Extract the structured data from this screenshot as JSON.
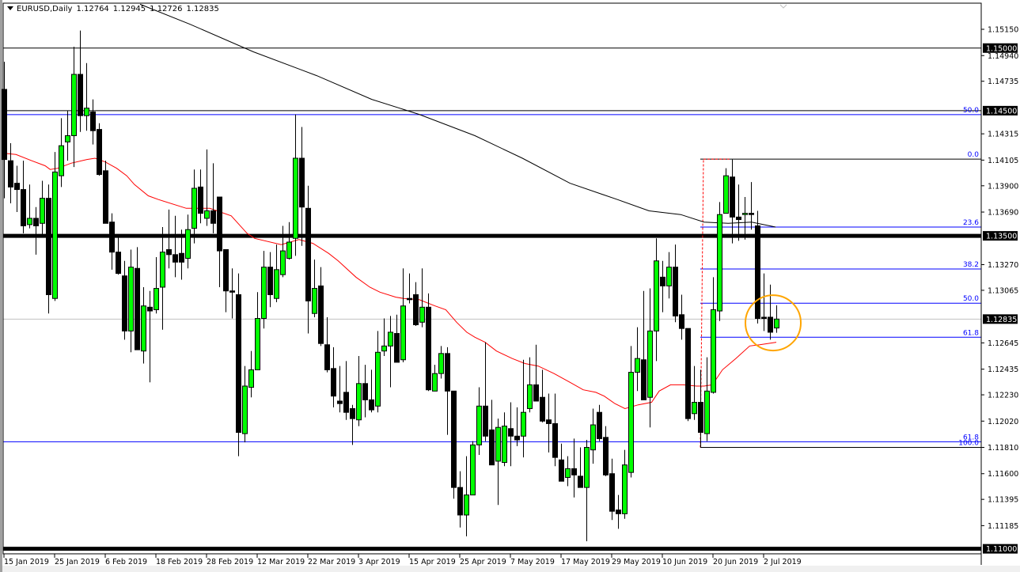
{
  "header": {
    "symbol_timeframe": "EURUSD,Daily",
    "open": "1.12764",
    "high": "1.12945",
    "low": "1.12726",
    "close": "1.12835"
  },
  "colors": {
    "bull_body": "#00ff00",
    "bear_body": "#000000",
    "ma_fast": "#ff0000",
    "ma_slow": "#000000",
    "fib": "#0000ff",
    "highlight_circle": "#ffa500",
    "current_price_line": "#c0c0c0"
  },
  "chart_data": {
    "type": "candlestick",
    "title": "EURUSD,Daily",
    "ylim": [
      1.10975,
      1.15384
    ],
    "y_ticks": [
      "1.15150",
      "1.14940",
      "1.14735",
      "1.14315",
      "1.14105",
      "1.13900",
      "1.13690",
      "1.13270",
      "1.13065",
      "1.12645",
      "1.12435",
      "1.12230",
      "1.12020",
      "1.11810",
      "1.11600",
      "1.11395",
      "1.11185"
    ],
    "x_ticks": [
      {
        "index": 0,
        "label": "15 Jan 2019"
      },
      {
        "index": 8,
        "label": "25 Jan 2019"
      },
      {
        "index": 16,
        "label": "6 Feb 2019"
      },
      {
        "index": 24,
        "label": "18 Feb 2019"
      },
      {
        "index": 32,
        "label": "28 Feb 2019"
      },
      {
        "index": 40,
        "label": "12 Mar 2019"
      },
      {
        "index": 48,
        "label": "22 Mar 2019"
      },
      {
        "index": 56,
        "label": "3 Apr 2019"
      },
      {
        "index": 64,
        "label": "15 Apr 2019"
      },
      {
        "index": 72,
        "label": "25 Apr 2019"
      },
      {
        "index": 80,
        "label": "7 May 2019"
      },
      {
        "index": 88,
        "label": "17 May 2019"
      },
      {
        "index": 96,
        "label": "29 May 2019"
      },
      {
        "index": 104,
        "label": "10 Jun 2019"
      },
      {
        "index": 112,
        "label": "20 Jun 2019"
      },
      {
        "index": 120,
        "label": "2 Jul 2019"
      }
    ],
    "ohlc_order": [
      "open",
      "high",
      "low",
      "close"
    ],
    "candles": [
      [
        1.1467,
        1.1489,
        1.138,
        1.1411
      ],
      [
        1.141,
        1.1424,
        1.1376,
        1.1389
      ],
      [
        1.1392,
        1.1406,
        1.1369,
        1.1387
      ],
      [
        1.1387,
        1.141,
        1.1352,
        1.1358
      ],
      [
        1.1359,
        1.1391,
        1.1356,
        1.1364
      ],
      [
        1.1364,
        1.1373,
        1.1335,
        1.1358
      ],
      [
        1.136,
        1.1394,
        1.1351,
        1.138
      ],
      [
        1.138,
        1.1391,
        1.1288,
        1.1303
      ],
      [
        1.13,
        1.1417,
        1.1298,
        1.1401
      ],
      [
        1.1398,
        1.1444,
        1.1389,
        1.1422
      ],
      [
        1.1425,
        1.145,
        1.141,
        1.143
      ],
      [
        1.143,
        1.1501,
        1.1405,
        1.1479
      ],
      [
        1.1479,
        1.1514,
        1.1433,
        1.1446
      ],
      [
        1.1446,
        1.1488,
        1.1434,
        1.1452
      ],
      [
        1.1449,
        1.1459,
        1.1423,
        1.1434
      ],
      [
        1.1435,
        1.144,
        1.1398,
        1.1399
      ],
      [
        1.1402,
        1.141,
        1.136,
        1.136
      ],
      [
        1.1361,
        1.1368,
        1.1323,
        1.1337
      ],
      [
        1.1337,
        1.1349,
        1.1319,
        1.132
      ],
      [
        1.1318,
        1.133,
        1.1267,
        1.1274
      ],
      [
        1.1274,
        1.1339,
        1.1257,
        1.1325
      ],
      [
        1.1324,
        1.1341,
        1.1259,
        1.1259
      ],
      [
        1.1258,
        1.1309,
        1.1248,
        1.1294
      ],
      [
        1.1293,
        1.1306,
        1.1233,
        1.129
      ],
      [
        1.1291,
        1.1333,
        1.1288,
        1.1308
      ],
      [
        1.1309,
        1.1357,
        1.1275,
        1.1337
      ],
      [
        1.1339,
        1.1371,
        1.1324,
        1.1335
      ],
      [
        1.1335,
        1.1366,
        1.1317,
        1.1329
      ],
      [
        1.1336,
        1.1355,
        1.1315,
        1.1329
      ],
      [
        1.1332,
        1.1367,
        1.1324,
        1.1355
      ],
      [
        1.1356,
        1.1403,
        1.1344,
        1.1388
      ],
      [
        1.1389,
        1.1403,
        1.136,
        1.1368
      ],
      [
        1.1364,
        1.1419,
        1.1358,
        1.137
      ],
      [
        1.137,
        1.1408,
        1.1352,
        1.136
      ],
      [
        1.1381,
        1.1381,
        1.1309,
        1.1338
      ],
      [
        1.1339,
        1.1339,
        1.1289,
        1.1306
      ],
      [
        1.1306,
        1.1324,
        1.1284,
        1.1305
      ],
      [
        1.1303,
        1.132,
        1.1174,
        1.1193
      ],
      [
        1.1192,
        1.1246,
        1.1185,
        1.123
      ],
      [
        1.1229,
        1.1258,
        1.1221,
        1.1243
      ],
      [
        1.1243,
        1.1305,
        1.1243,
        1.1284
      ],
      [
        1.1284,
        1.1338,
        1.1276,
        1.1325
      ],
      [
        1.1325,
        1.1337,
        1.1293,
        1.1303
      ],
      [
        1.13,
        1.1343,
        1.1297,
        1.1323
      ],
      [
        1.1319,
        1.1358,
        1.1317,
        1.1338
      ],
      [
        1.1332,
        1.1361,
        1.1331,
        1.1345
      ],
      [
        1.1348,
        1.1447,
        1.1334,
        1.1412
      ],
      [
        1.1412,
        1.1437,
        1.1342,
        1.1373
      ],
      [
        1.1372,
        1.139,
        1.1272,
        1.1298
      ],
      [
        1.1288,
        1.1331,
        1.1285,
        1.1308
      ],
      [
        1.131,
        1.1325,
        1.1262,
        1.1264
      ],
      [
        1.1263,
        1.1285,
        1.1241,
        1.1243
      ],
      [
        1.1244,
        1.1261,
        1.1213,
        1.1222
      ],
      [
        1.1218,
        1.1246,
        1.1209,
        1.1216
      ],
      [
        1.1225,
        1.125,
        1.1203,
        1.1209
      ],
      [
        1.1212,
        1.1215,
        1.1183,
        1.1204
      ],
      [
        1.1203,
        1.1254,
        1.1198,
        1.1232
      ],
      [
        1.1232,
        1.1247,
        1.1205,
        1.1219
      ],
      [
        1.1219,
        1.1243,
        1.1209,
        1.1211
      ],
      [
        1.1214,
        1.1274,
        1.1209,
        1.1257
      ],
      [
        1.1258,
        1.1284,
        1.1254,
        1.1262
      ],
      [
        1.1262,
        1.1286,
        1.1229,
        1.1273
      ],
      [
        1.1272,
        1.1287,
        1.1249,
        1.1249
      ],
      [
        1.1251,
        1.1324,
        1.1249,
        1.1294
      ],
      [
        1.13,
        1.132,
        1.1296,
        1.1299
      ],
      [
        1.1303,
        1.1313,
        1.1278,
        1.1279
      ],
      [
        1.1281,
        1.1324,
        1.1277,
        1.1293
      ],
      [
        1.1293,
        1.1304,
        1.1226,
        1.1227
      ],
      [
        1.1226,
        1.1247,
        1.1226,
        1.124
      ],
      [
        1.124,
        1.1262,
        1.1236,
        1.1256
      ],
      [
        1.1256,
        1.1261,
        1.1191,
        1.1226
      ],
      [
        1.1226,
        1.1226,
        1.114,
        1.1149
      ],
      [
        1.1149,
        1.1162,
        1.1117,
        1.1127
      ],
      [
        1.1127,
        1.1174,
        1.111,
        1.1143
      ],
      [
        1.1143,
        1.1186,
        1.1143,
        1.1183
      ],
      [
        1.1183,
        1.1229,
        1.1175,
        1.1214
      ],
      [
        1.1214,
        1.1265,
        1.1186,
        1.119
      ],
      [
        1.1195,
        1.1219,
        1.1167,
        1.1167
      ],
      [
        1.117,
        1.1204,
        1.1135,
        1.1197
      ],
      [
        1.1169,
        1.1209,
        1.1166,
        1.1198
      ],
      [
        1.1196,
        1.1217,
        1.1166,
        1.119
      ],
      [
        1.119,
        1.1213,
        1.1182,
        1.1187
      ],
      [
        1.119,
        1.1251,
        1.1173,
        1.1209
      ],
      [
        1.1212,
        1.1253,
        1.1209,
        1.1231
      ],
      [
        1.1231,
        1.1263,
        1.1218,
        1.1218
      ],
      [
        1.1221,
        1.1243,
        1.1201,
        1.1202
      ],
      [
        1.1203,
        1.1224,
        1.1177,
        1.12
      ],
      [
        1.12,
        1.1224,
        1.1166,
        1.1173
      ],
      [
        1.1171,
        1.1184,
        1.1154,
        1.1154
      ],
      [
        1.1157,
        1.1174,
        1.115,
        1.1164
      ],
      [
        1.1164,
        1.1188,
        1.1141,
        1.1159
      ],
      [
        1.1158,
        1.1181,
        1.1149,
        1.1149
      ],
      [
        1.1149,
        1.1187,
        1.1106,
        1.1181
      ],
      [
        1.1179,
        1.1212,
        1.1168,
        1.1199
      ],
      [
        1.1209,
        1.1215,
        1.1186,
        1.1188
      ],
      [
        1.1189,
        1.1198,
        1.1158,
        1.1159
      ],
      [
        1.116,
        1.1172,
        1.1123,
        1.113
      ],
      [
        1.1131,
        1.1143,
        1.1116,
        1.1128
      ],
      [
        1.1128,
        1.1179,
        1.1124,
        1.1167
      ],
      [
        1.1161,
        1.1262,
        1.1157,
        1.1241
      ],
      [
        1.1241,
        1.1277,
        1.1226,
        1.1252
      ],
      [
        1.1251,
        1.1306,
        1.1219,
        1.1219
      ],
      [
        1.1221,
        1.1308,
        1.1197,
        1.1274
      ],
      [
        1.1274,
        1.1348,
        1.125,
        1.133
      ],
      [
        1.1317,
        1.133,
        1.1289,
        1.131
      ],
      [
        1.131,
        1.1337,
        1.13,
        1.1325
      ],
      [
        1.1325,
        1.1343,
        1.1281,
        1.1286
      ],
      [
        1.1287,
        1.1303,
        1.1267,
        1.1276
      ],
      [
        1.1276,
        1.1276,
        1.1202,
        1.1204
      ],
      [
        1.1208,
        1.1246,
        1.1203,
        1.1217
      ],
      [
        1.1217,
        1.1243,
        1.1181,
        1.1193
      ],
      [
        1.1192,
        1.1253,
        1.1186,
        1.1226
      ],
      [
        1.1225,
        1.1317,
        1.1224,
        1.1291
      ],
      [
        1.129,
        1.1377,
        1.1282,
        1.1367
      ],
      [
        1.1368,
        1.1404,
        1.1368,
        1.1398
      ],
      [
        1.1397,
        1.1411,
        1.1344,
        1.1365
      ],
      [
        1.1365,
        1.1391,
        1.1346,
        1.1363
      ],
      [
        1.1367,
        1.1381,
        1.1347,
        1.1368
      ],
      [
        1.1368,
        1.1393,
        1.1355,
        1.1367
      ],
      [
        1.1358,
        1.137,
        1.128,
        1.1284
      ],
      [
        1.1285,
        1.132,
        1.1274,
        1.1284
      ],
      [
        1.1285,
        1.1311,
        1.1267,
        1.1273
      ],
      [
        1.12764,
        1.12945,
        1.12726,
        1.12835
      ]
    ],
    "series": [
      {
        "name": "ma_fast",
        "points": [
          [
            0,
            1.1416
          ],
          [
            1.9,
            1.1415
          ],
          [
            4.4,
            1.141
          ],
          [
            6.5,
            1.1406
          ],
          [
            7.3,
            1.1403
          ],
          [
            8.5,
            1.1404
          ],
          [
            10.6,
            1.1408
          ],
          [
            13.1,
            1.1411
          ],
          [
            14.4,
            1.1412
          ],
          [
            16,
            1.1409
          ],
          [
            17.8,
            1.1404
          ],
          [
            19.4,
            1.1398
          ],
          [
            20.6,
            1.1391
          ],
          [
            22.8,
            1.1382
          ],
          [
            24.4,
            1.1379
          ],
          [
            28.8,
            1.1372
          ],
          [
            32.5,
            1.1372
          ],
          [
            35.9,
            1.1366
          ],
          [
            38.4,
            1.1352
          ],
          [
            39.6,
            1.1348
          ],
          [
            43.8,
            1.1343
          ],
          [
            46.6,
            1.1347
          ],
          [
            48.8,
            1.1344
          ],
          [
            51.3,
            1.1336
          ],
          [
            52.8,
            1.133
          ],
          [
            55.6,
            1.1317
          ],
          [
            57.8,
            1.1309
          ],
          [
            59.4,
            1.1305
          ],
          [
            61.9,
            1.1301
          ],
          [
            63.1,
            1.13
          ],
          [
            65.6,
            1.1299
          ],
          [
            68.1,
            1.1294
          ],
          [
            69.8,
            1.1291
          ],
          [
            71.5,
            1.1281
          ],
          [
            73.1,
            1.1273
          ],
          [
            74.4,
            1.1269
          ],
          [
            76,
            1.1265
          ],
          [
            77.8,
            1.1258
          ],
          [
            80.3,
            1.1252
          ],
          [
            82.3,
            1.1248
          ],
          [
            84.4,
            1.1246
          ],
          [
            86.9,
            1.124
          ],
          [
            89.4,
            1.1233
          ],
          [
            91.5,
            1.1227
          ],
          [
            93.5,
            1.1225
          ],
          [
            94.8,
            1.1222
          ],
          [
            96.5,
            1.1216
          ],
          [
            98.1,
            1.1212
          ],
          [
            100.2,
            1.1215
          ],
          [
            102.3,
            1.1217
          ],
          [
            103.5,
            1.1226
          ],
          [
            105.3,
            1.1231
          ],
          [
            107.3,
            1.1231
          ],
          [
            109.4,
            1.123
          ],
          [
            110.6,
            1.123
          ],
          [
            111.9,
            1.1231
          ],
          [
            113.5,
            1.1243
          ],
          [
            115.6,
            1.1252
          ],
          [
            117.8,
            1.1262
          ],
          [
            119.4,
            1.1263
          ],
          [
            122,
            1.1265
          ]
        ]
      },
      {
        "name": "ma_slow",
        "points": [
          [
            21.5,
            1.1535
          ],
          [
            29.4,
            1.1519
          ],
          [
            39.4,
            1.1497
          ],
          [
            49.4,
            1.1478
          ],
          [
            58.1,
            1.1459
          ],
          [
            65.6,
            1.1447
          ],
          [
            74.4,
            1.143
          ],
          [
            81.9,
            1.1412
          ],
          [
            89.4,
            1.1392
          ],
          [
            96.9,
            1.1379
          ],
          [
            101.9,
            1.137
          ],
          [
            106.9,
            1.1367
          ],
          [
            110.6,
            1.1361
          ],
          [
            114.4,
            1.136
          ],
          [
            118.1,
            1.1361
          ],
          [
            121.9,
            1.1357
          ]
        ]
      }
    ],
    "horizontal_levels": [
      {
        "price": 1.15,
        "label": "1.15000",
        "style": "thin"
      },
      {
        "price": 1.145,
        "label": "1.14500",
        "style": "thin"
      },
      {
        "price": 1.135,
        "label": "1.13500",
        "style": "thick"
      },
      {
        "price": 1.11,
        "label": "1.11000",
        "style": "thick"
      }
    ],
    "current_price": {
      "price": 1.12835,
      "label": "1.12835"
    },
    "fib_retracement": {
      "from_index": 110,
      "swing_low": 1.1181,
      "swing_high": 1.14113,
      "levels": [
        {
          "label": "0.0",
          "price": 1.14113
        },
        {
          "label": "23.6",
          "price": 1.1357
        },
        {
          "label": "38.2",
          "price": 1.13235
        },
        {
          "label": "50.0",
          "price": 1.12962
        },
        {
          "label": "61.8",
          "price": 1.1269
        },
        {
          "label": "100.0",
          "price": 1.1181
        }
      ]
    },
    "fib_retracement_2": {
      "levels": [
        {
          "label": "50.0",
          "price": 1.14468
        },
        {
          "label": "61.8",
          "price": 1.11855
        }
      ]
    },
    "annotation_circle": {
      "center_index": 121.5,
      "center_price": 1.12805
    }
  }
}
